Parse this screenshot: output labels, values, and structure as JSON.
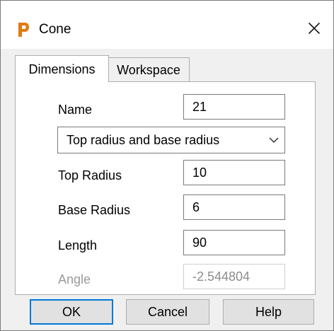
{
  "window": {
    "title": "Cone",
    "app_icon": "P",
    "close_icon": "close-icon"
  },
  "tabs": [
    {
      "label": "Dimensions",
      "active": true
    },
    {
      "label": "Workspace",
      "active": false
    }
  ],
  "form": {
    "name": {
      "label": "Name",
      "value": "21"
    },
    "mode": {
      "selected": "Top radius and base radius"
    },
    "top_radius": {
      "label": "Top Radius",
      "value": "10"
    },
    "base_radius": {
      "label": "Base Radius",
      "value": "6"
    },
    "length": {
      "label": "Length",
      "value": "90"
    },
    "angle": {
      "label": "Angle",
      "value": "-2.544804",
      "enabled": false
    }
  },
  "buttons": {
    "ok": "OK",
    "cancel": "Cancel",
    "help": "Help"
  },
  "colors": {
    "app_icon": "#e07b12",
    "focus": "#0078d7"
  }
}
